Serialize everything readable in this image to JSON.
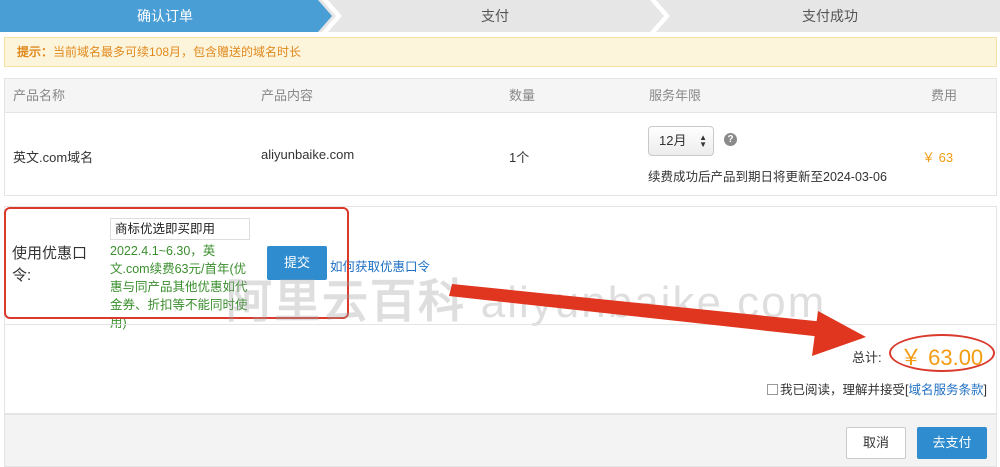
{
  "steps": [
    {
      "label": "确认订单",
      "active": true
    },
    {
      "label": "支付",
      "active": false
    },
    {
      "label": "支付成功",
      "active": false
    }
  ],
  "notice": {
    "prefix": "提示：",
    "text": "当前域名最多可续108月，包含赠送的域名时长"
  },
  "table": {
    "headers": {
      "product_name": "产品名称",
      "product_content": "产品内容",
      "quantity": "数量",
      "service_period": "服务年限",
      "fee": "费用"
    },
    "row": {
      "product_name": "英文.com域名",
      "product_content": "aliyunbaike.com",
      "quantity": "1个",
      "period_selected": "12月",
      "expire_note": "续费成功后产品到期日将更新至2024-03-06",
      "fee": "￥ 63"
    }
  },
  "coupon": {
    "label": "使用优惠口令:",
    "input_value": "商标优选即买即用",
    "description": "2022.4.1~6.30，英文.com续费63元/首年(优惠与同产品其他优惠如代金券、折扣等不能同时使用)",
    "submit_label": "提交",
    "link_text": "如何获取优惠口令"
  },
  "watermark": {
    "cn": "阿里云百科",
    "en": "aliyunbaike.com"
  },
  "total": {
    "label": "总计:",
    "amount": "￥ 63.00"
  },
  "agreement": {
    "text": "我已阅读，理解并接受[",
    "link": "域名服务条款",
    "close": "]"
  },
  "buttons": {
    "cancel": "取消",
    "pay": "去支付"
  },
  "colors": {
    "primary": "#2e8ccf",
    "accent_orange": "#f39c12",
    "annotation_red": "#d93a2b",
    "coupon_green": "#3a8e2d"
  }
}
